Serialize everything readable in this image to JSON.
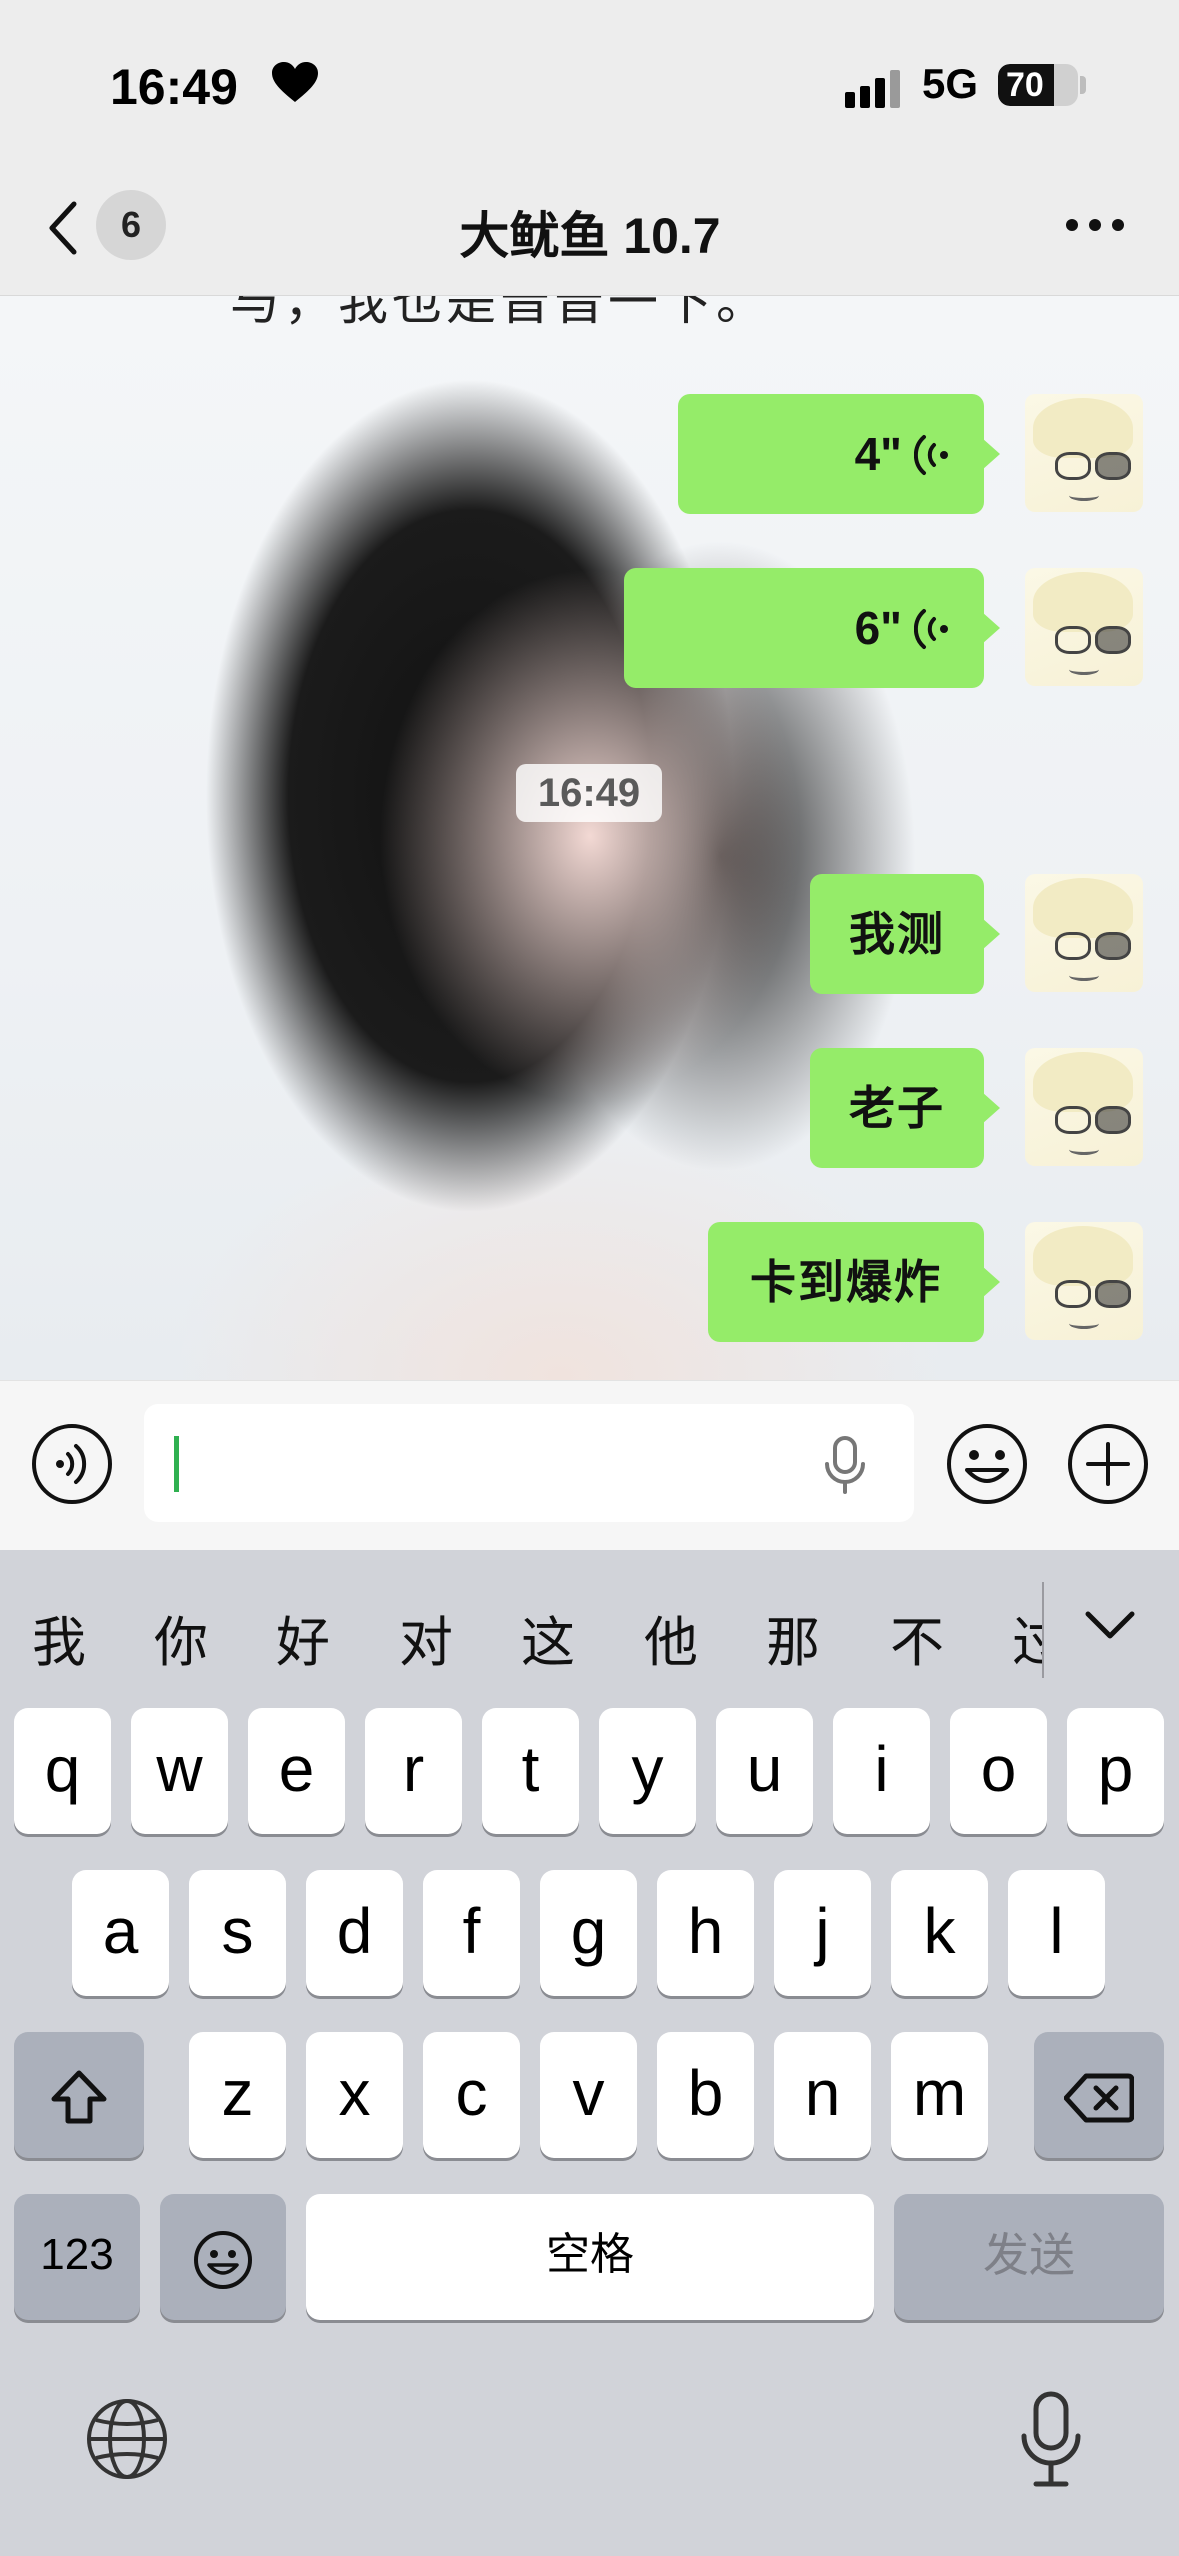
{
  "status_bar": {
    "time": "16:49",
    "network": "5G",
    "battery": "70",
    "battery_level": 0.7
  },
  "header": {
    "unread_count": "6",
    "title": "大鱿鱼 10.7"
  },
  "chat": {
    "partial_text": "与，我也是晋晋一下。",
    "timestamp": "16:49",
    "messages": [
      {
        "type": "voice",
        "duration": "4\""
      },
      {
        "type": "voice",
        "duration": "6\""
      },
      {
        "type": "text",
        "text": "我测"
      },
      {
        "type": "text",
        "text": "老子"
      },
      {
        "type": "text",
        "text": "卡到爆炸"
      }
    ]
  },
  "input": {
    "value": ""
  },
  "keyboard": {
    "candidates": [
      "我",
      "你",
      "好",
      "对",
      "这",
      "他",
      "那",
      "不",
      "过"
    ],
    "row1": [
      "q",
      "w",
      "e",
      "r",
      "t",
      "y",
      "u",
      "i",
      "o",
      "p"
    ],
    "row2": [
      "a",
      "s",
      "d",
      "f",
      "g",
      "h",
      "j",
      "k",
      "l"
    ],
    "row3": [
      "z",
      "x",
      "c",
      "v",
      "b",
      "n",
      "m"
    ],
    "numbers_key": "123",
    "space_label": "空格",
    "send_label": "发送"
  },
  "colors": {
    "bubble": "#95ec69",
    "caret": "#2fb050",
    "keyboard_bg": "#d1d3d9"
  }
}
